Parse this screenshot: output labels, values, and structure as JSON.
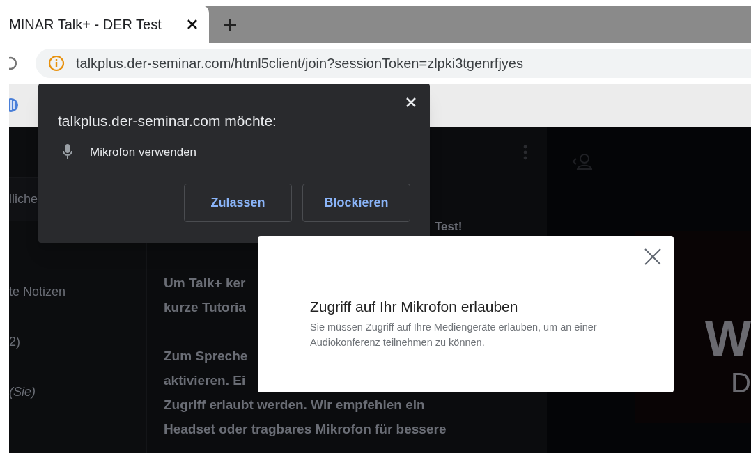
{
  "browser": {
    "tab": {
      "title": "MINAR Talk+ - DER Test",
      "selected": true
    },
    "address": "talkplus.der-seminar.com/html5client/join?sessionToken=zlpki3tgenrfjyes"
  },
  "permission_popup": {
    "title": "talkplus.der-seminar.com möchte:",
    "request": "Mikrofon verwenden",
    "buttons": [
      "Zulassen",
      "Blockieren"
    ]
  },
  "sidebar": {
    "items": [
      {
        "label": "lliche",
        "selected": true
      },
      {
        "label": "te Notizen",
        "selected": false
      },
      {
        "label": "2)",
        "selected": false
      },
      {
        "label": "(Sie)",
        "selected": false
      }
    ]
  },
  "content": {
    "heading_tail": "Test!",
    "paragraphs": [
      [
        "Um Talk+ ker",
        "kurze Tutoria"
      ],
      [
        "Zum Spreche",
        "aktivieren. Ei",
        "Zugriff erlaubt werden. Wir empfehlen ein",
        "Headset oder tragbares Mikrofon für bessere"
      ]
    ]
  },
  "slide": {
    "texts": [
      "W",
      "D"
    ]
  },
  "modal": {
    "title": "Zugriff auf Ihr Mikrofon erlauben",
    "message": "Sie müssen Zugriff auf Ihre Mediengeräte erlauben, um an einer Audiokonferenz teilnehmen zu können."
  }
}
